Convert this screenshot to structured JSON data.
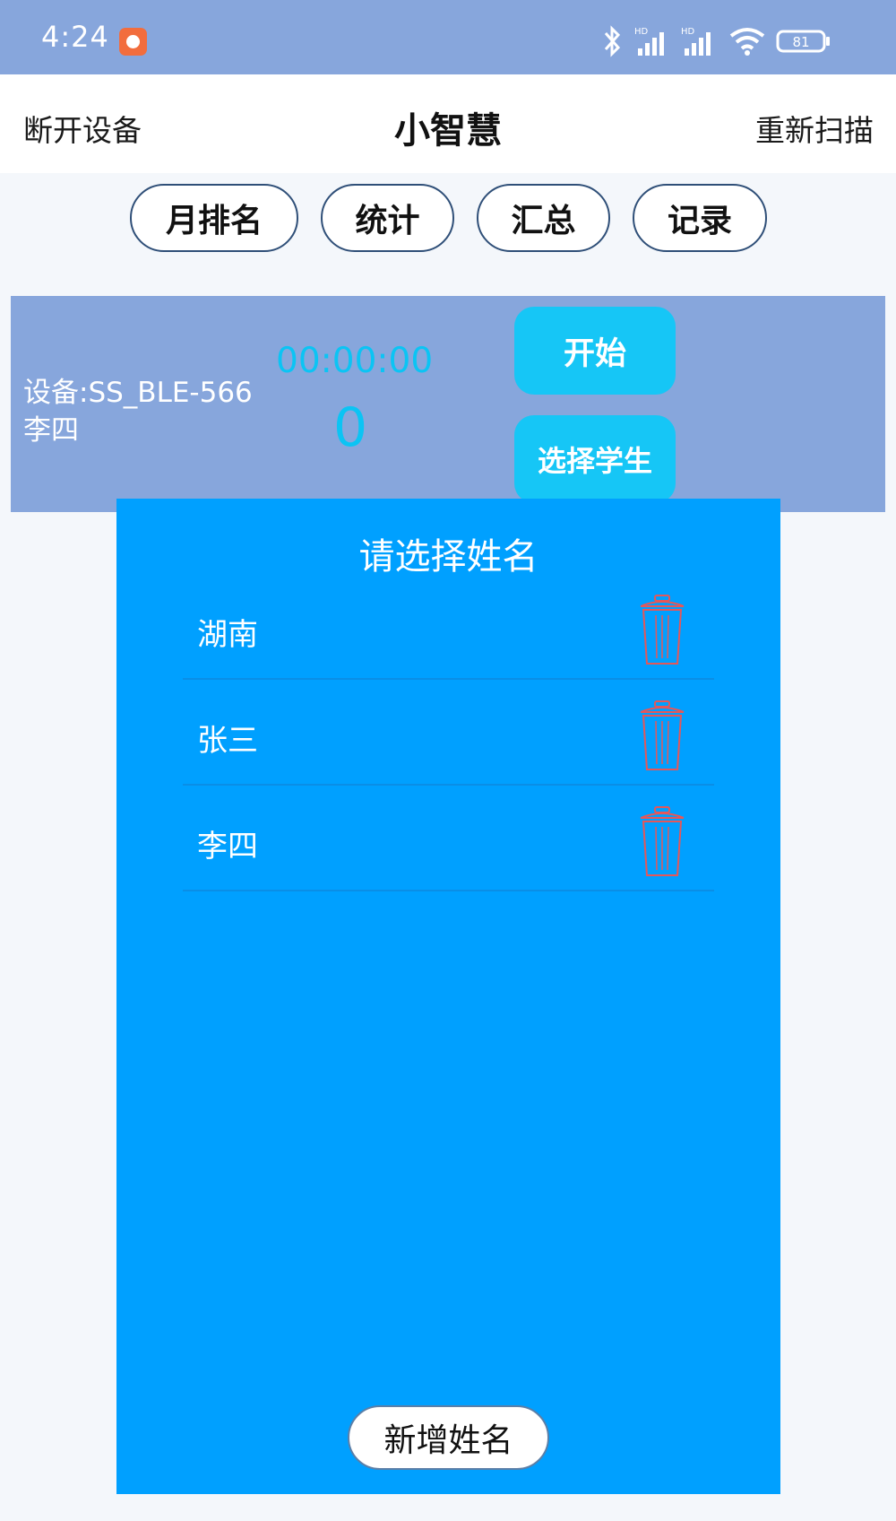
{
  "status_bar": {
    "time": "4:24",
    "battery": "81",
    "icons": [
      "app-notification-icon",
      "bluetooth-icon",
      "hd-signal-icon",
      "hd-signal-icon",
      "wifi-icon",
      "battery-icon"
    ]
  },
  "top_bar": {
    "left_action": "断开设备",
    "title": "小智慧",
    "right_action": "重新扫描"
  },
  "tabs": [
    "月排名",
    "统计",
    "汇总",
    "记录"
  ],
  "device_panel": {
    "device": "设备:SS_BLE-566",
    "student": "李四",
    "timer": "00:00:00",
    "count": "0",
    "start_label": "开始",
    "select_label": "选择学生"
  },
  "dialog": {
    "title": "请选择姓名",
    "names": [
      "湖南",
      "张三",
      "李四"
    ],
    "add_label": "新增姓名"
  },
  "colors": {
    "status_bar": "#87a6dc",
    "dialog": "#00a0ff",
    "button": "#16c6f6",
    "timer": "#0bc4f4",
    "trash": "#e4575a"
  }
}
